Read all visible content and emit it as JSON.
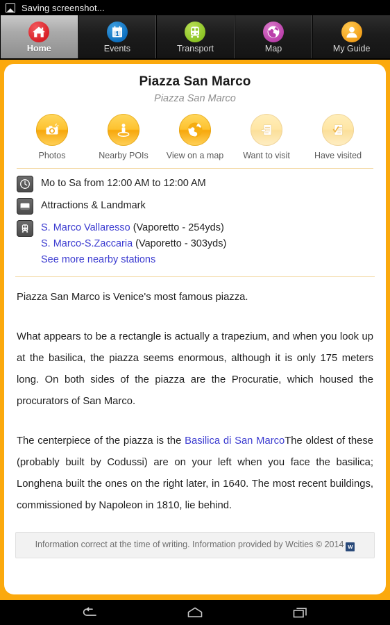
{
  "status_bar": {
    "icon": "screenshot-image-icon",
    "text": "Saving screenshot..."
  },
  "tabs": [
    {
      "label": "Home",
      "icon": "home-icon",
      "color": "#d81f26",
      "active": true
    },
    {
      "label": "Events",
      "icon": "calendar-icon",
      "color": "#0d6fbf",
      "active": false
    },
    {
      "label": "Transport",
      "icon": "train-icon",
      "color": "#8cc425",
      "active": false
    },
    {
      "label": "Map",
      "icon": "globe-icon",
      "color": "#bb40ab",
      "active": false
    },
    {
      "label": "My Guide",
      "icon": "person-icon",
      "color": "#f2a01b",
      "active": false
    }
  ],
  "detail": {
    "title": "Piazza San Marco",
    "subtitle": "Piazza San Marco",
    "actions": [
      {
        "label": "Photos",
        "icon": "camera-icon",
        "faded": false
      },
      {
        "label": "Nearby POIs",
        "icon": "person-pin-icon",
        "faded": false
      },
      {
        "label": "View on a map",
        "icon": "globe-icon",
        "faded": false
      },
      {
        "label": "Want to visit",
        "icon": "document-add-icon",
        "faded": true
      },
      {
        "label": "Have visited",
        "icon": "document-check-icon",
        "faded": true
      }
    ],
    "info_rows": [
      {
        "icon": "clock-icon",
        "text": "Mo to Sa from 12:00 AM to 12:00 AM"
      },
      {
        "icon": "folder-icon",
        "text": "Attractions & Landmark"
      }
    ],
    "transit": {
      "icon": "train-station-icon",
      "stations": [
        {
          "name": "S. Marco Vallaresso",
          "detail": " (Vaporetto - 254yds)"
        },
        {
          "name": "S. Marco-S.Zaccaria",
          "detail": " (Vaporetto - 303yds)"
        }
      ],
      "more_link": "See more nearby stations"
    },
    "body": {
      "paragraph_1": "Piazza San Marco is Venice's most famous piazza.",
      "paragraph_2": "What appears to be a rectangle is actually a trapezium, and when you look up at the basilica, the piazza seems enormous, although it is only 175 meters long. On both sides of the piazza are the Procuratie, which housed the procurators of San Marco.",
      "paragraph_3_pre": "The centerpiece of the piazza is the ",
      "paragraph_3_link": "Basilica di San Marco",
      "paragraph_3_post": "The oldest of these (probably built by Codussi) are on your left when you face the basilica; Longhena built the ones on the right later, in 1640. The most recent buildings, commissioned by Napoleon in 1810, lie behind."
    },
    "disclaimer": {
      "text": "Information correct at the time of writing. Information provided by Wcities © 2014",
      "badge": "w"
    }
  },
  "nav_bar": {
    "back": "back-icon",
    "home": "home-icon",
    "recents": "recents-icon"
  },
  "colors": {
    "frame_orange": "#fba90d",
    "link_blue": "#3b3bd0",
    "divider": "#f3d9a4"
  }
}
